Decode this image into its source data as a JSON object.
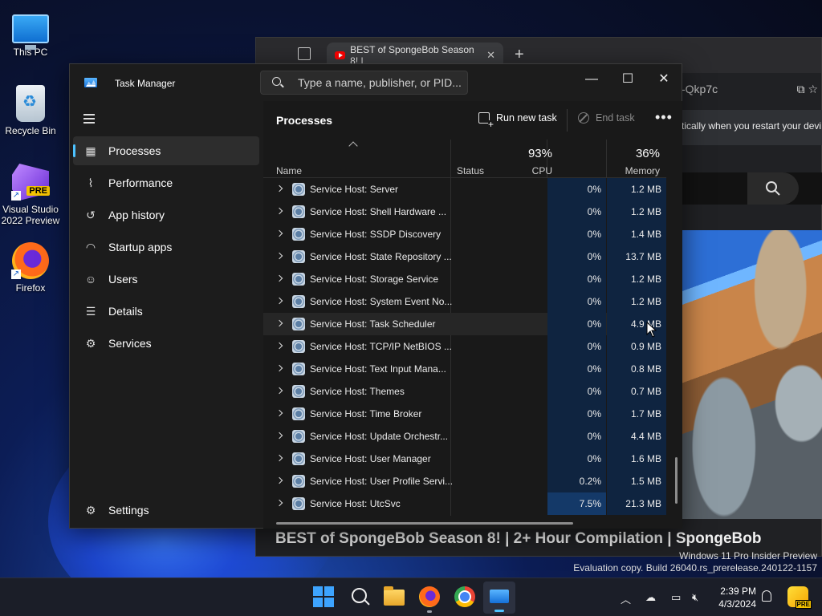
{
  "desktop": {
    "icons": [
      {
        "label": "This PC"
      },
      {
        "label": "Recycle Bin"
      },
      {
        "label": "Visual Studio 2022 Preview",
        "badge": "PRE"
      },
      {
        "label": "Firefox"
      }
    ]
  },
  "browser": {
    "tab_title": "BEST of SpongeBob Season 8! |",
    "tab_close": "✕",
    "new_tab": "+",
    "address_fragment": "-Qkp7c",
    "infobar_text": "tically when you restart your devi",
    "video_title": "BEST of SpongeBob Season 8! | 2+ Hour Compilation | SpongeBob"
  },
  "watermark": {
    "line1": "Windows 11 Pro Insider Preview",
    "line2": "Evaluation copy. Build 26040.rs_prerelease.240122-1157"
  },
  "task_manager": {
    "title": "Task Manager",
    "search_placeholder": "Type a name, publisher, or PID...",
    "window_controls": {
      "minimize": "—",
      "maximize": "☐",
      "close": "✕"
    },
    "nav": [
      {
        "label": "Processes",
        "icon": "processes-icon"
      },
      {
        "label": "Performance",
        "icon": "performance-icon"
      },
      {
        "label": "App history",
        "icon": "app-history-icon"
      },
      {
        "label": "Startup apps",
        "icon": "startup-apps-icon"
      },
      {
        "label": "Users",
        "icon": "users-icon"
      },
      {
        "label": "Details",
        "icon": "details-icon"
      },
      {
        "label": "Services",
        "icon": "services-icon"
      }
    ],
    "settings_label": "Settings",
    "processes": {
      "title": "Processes",
      "run_new_task": "Run new task",
      "end_task": "End task",
      "more": "•••",
      "columns": {
        "name": "Name",
        "status": "Status",
        "cpu_pct": "93%",
        "cpu": "CPU",
        "mem_pct": "36%",
        "memory": "Memory"
      },
      "rows": [
        {
          "name": "Service Host: Server",
          "cpu": "0%",
          "memory": "1.2 MB"
        },
        {
          "name": "Service Host: Shell Hardware ...",
          "cpu": "0%",
          "memory": "1.2 MB"
        },
        {
          "name": "Service Host: SSDP Discovery",
          "cpu": "0%",
          "memory": "1.4 MB"
        },
        {
          "name": "Service Host: State Repository ...",
          "cpu": "0%",
          "memory": "13.7 MB"
        },
        {
          "name": "Service Host: Storage Service",
          "cpu": "0%",
          "memory": "1.2 MB"
        },
        {
          "name": "Service Host: System Event No...",
          "cpu": "0%",
          "memory": "1.2 MB"
        },
        {
          "name": "Service Host: Task Scheduler",
          "cpu": "0%",
          "memory": "4.9 MB"
        },
        {
          "name": "Service Host: TCP/IP NetBIOS ...",
          "cpu": "0%",
          "memory": "0.9 MB"
        },
        {
          "name": "Service Host: Text Input Mana...",
          "cpu": "0%",
          "memory": "0.8 MB"
        },
        {
          "name": "Service Host: Themes",
          "cpu": "0%",
          "memory": "0.7 MB"
        },
        {
          "name": "Service Host: Time Broker",
          "cpu": "0%",
          "memory": "1.7 MB"
        },
        {
          "name": "Service Host: Update Orchestr...",
          "cpu": "0%",
          "memory": "4.4 MB"
        },
        {
          "name": "Service Host: User Manager",
          "cpu": "0%",
          "memory": "1.6 MB"
        },
        {
          "name": "Service Host: User Profile Servi...",
          "cpu": "0.2%",
          "memory": "1.5 MB"
        },
        {
          "name": "Service Host: UtcSvc",
          "cpu": "7.5%",
          "memory": "21.3 MB"
        }
      ]
    }
  },
  "taskbar": {
    "time": "2:39 PM",
    "date": "4/3/2024",
    "copilot_badge": "PRE"
  },
  "colors": {
    "accent": "#4cc2ff",
    "cpu_heat": "#143968",
    "window_bg": "#1c1c1c"
  }
}
